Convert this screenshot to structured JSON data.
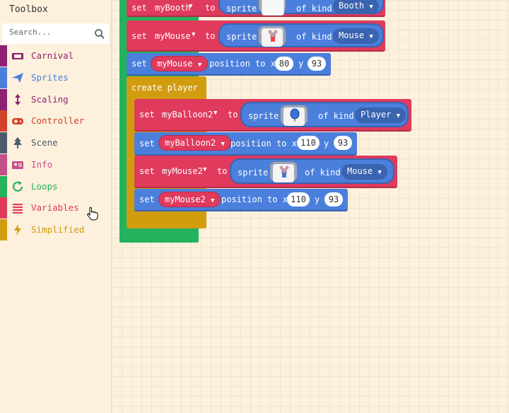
{
  "toolbox": {
    "title": "Toolbox",
    "search_placeholder": "Search...",
    "categories": [
      {
        "label": "Carnival",
        "color": "#8e1f72",
        "icon": "ticket-icon"
      },
      {
        "label": "Sprites",
        "color": "#4b7fdc",
        "icon": "paper-plane-icon"
      },
      {
        "label": "Scaling",
        "color": "#8e1f72",
        "icon": "vertical-arrows-icon"
      },
      {
        "label": "Controller",
        "color": "#d1432a",
        "icon": "gamepad-icon"
      },
      {
        "label": "Scene",
        "color": "#4c5b6b",
        "icon": "tree-icon"
      },
      {
        "label": "Info",
        "color": "#c24f8a",
        "icon": "id-card-icon"
      },
      {
        "label": "Loops",
        "color": "#23b35d",
        "icon": "refresh-icon"
      },
      {
        "label": "Variables",
        "color": "#e03a5d",
        "icon": "list-icon"
      },
      {
        "label": "Simplified",
        "color": "#d29c0f",
        "icon": "lightning-icon"
      }
    ]
  },
  "blocks": {
    "set_word": "set",
    "to_word": "to",
    "sprite_word": "sprite",
    "of_kind_word": "of kind",
    "position_to_x": "position to x",
    "y_word": "y",
    "create_player": "create player",
    "b1": {
      "var": "myBooth",
      "kind": "Booth"
    },
    "b2": {
      "var": "myMouse",
      "kind": "Mouse"
    },
    "b3": {
      "var": "myMouse",
      "x": "80",
      "y": "93"
    },
    "b4": {
      "var": "myBalloon2",
      "kind": "Player"
    },
    "b5": {
      "var": "myBalloon2",
      "x": "110",
      "y": "93"
    },
    "b6": {
      "var": "myMouse2",
      "kind": "Mouse"
    },
    "b7": {
      "var": "myMouse2",
      "x": "110",
      "y": "93"
    }
  },
  "colors": {
    "variables": "#e03a5d",
    "sprites": "#4b7fdc",
    "loops": "#23b35d",
    "functions": "#d29c0f"
  }
}
